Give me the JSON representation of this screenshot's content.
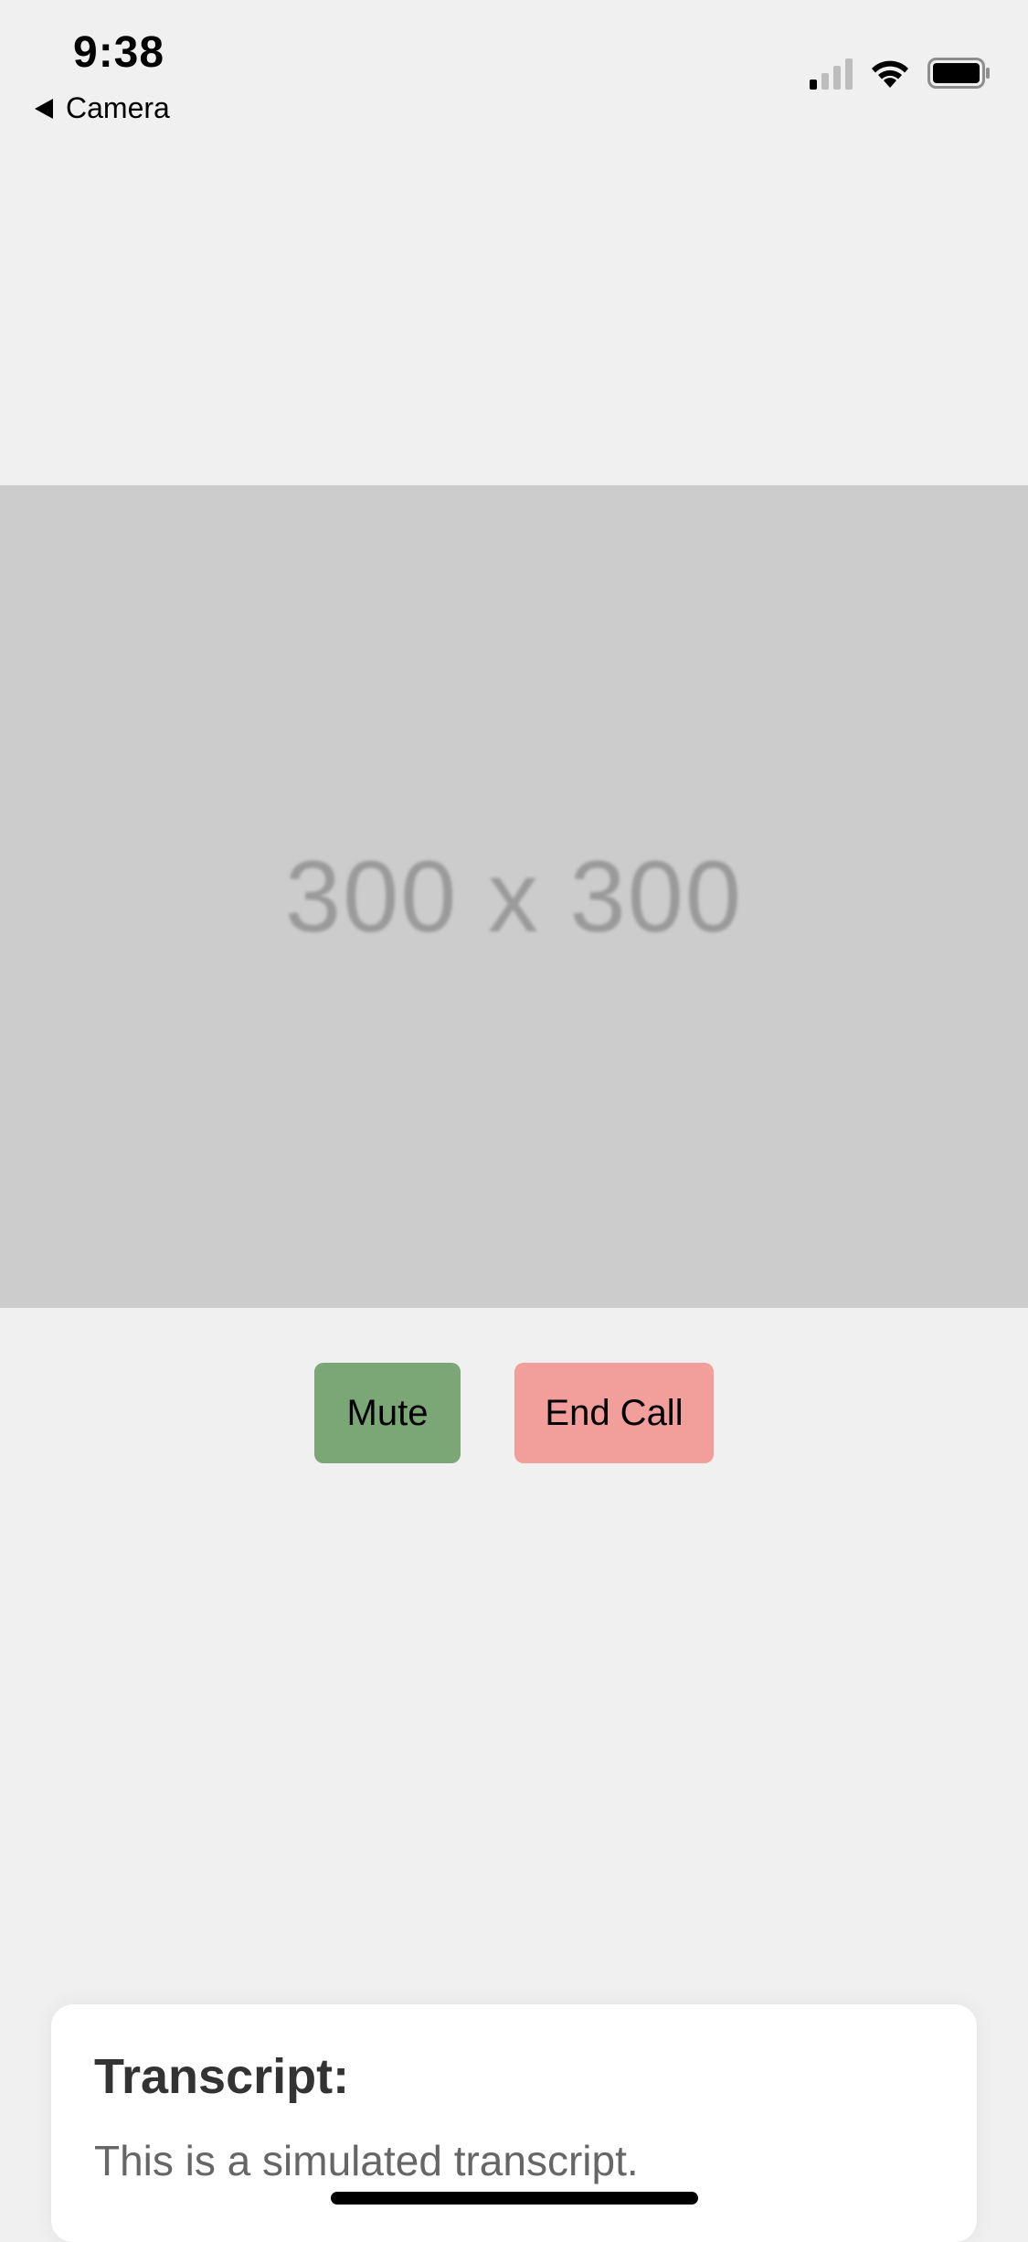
{
  "status_bar": {
    "time": "9:38",
    "back_label": "Camera",
    "icons": [
      "back-arrow-icon",
      "cellular-signal-icon",
      "wifi-icon",
      "battery-icon"
    ]
  },
  "image_placeholder": {
    "label": "300 x 300"
  },
  "controls": {
    "mute_label": "Mute",
    "end_call_label": "End Call"
  },
  "transcript": {
    "title": "Transcript:",
    "text": "This is a simulated transcript."
  },
  "colors": {
    "background": "#f0f0f0",
    "placeholder": "#cccccc",
    "mute_button": "#7aa775",
    "end_call_button": "#f29e9a"
  }
}
